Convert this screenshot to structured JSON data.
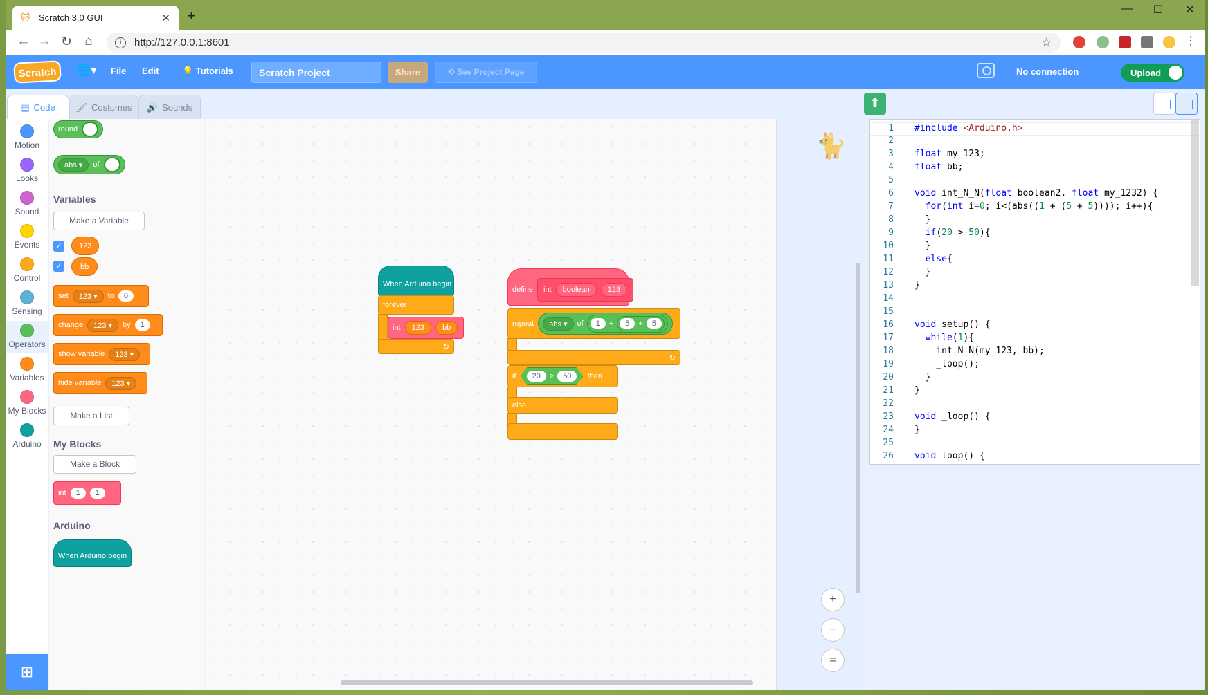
{
  "browser": {
    "tab_title": "Scratch 3.0 GUI",
    "url": "http://127.0.0.1:8601",
    "controls": {
      "minimize": "—",
      "maximize": "☐",
      "close": "✕",
      "new_tab": "+",
      "tab_close": "✕"
    }
  },
  "menubar": {
    "logo": "Scratch",
    "file": "File",
    "edit": "Edit",
    "tutorials": "Tutorials",
    "project_title": "Scratch Project",
    "share": "Share",
    "see_project_page": "See Project Page",
    "connection": "No connection",
    "upload": "Upload"
  },
  "tabs": {
    "code": "Code",
    "costumes": "Costumes",
    "sounds": "Sounds"
  },
  "categories": [
    {
      "label": "Motion",
      "color": "#4c97ff"
    },
    {
      "label": "Looks",
      "color": "#9966ff"
    },
    {
      "label": "Sound",
      "color": "#cf63cf"
    },
    {
      "label": "Events",
      "color": "#ffd500"
    },
    {
      "label": "Control",
      "color": "#ffab19"
    },
    {
      "label": "Sensing",
      "color": "#5cb1d6"
    },
    {
      "label": "Operators",
      "color": "#59c059"
    },
    {
      "label": "Variables",
      "color": "#ff8c1a"
    },
    {
      "label": "My Blocks",
      "color": "#ff6680"
    },
    {
      "label": "Arduino",
      "color": "#0fa0a0"
    }
  ],
  "palette": {
    "round_label": "round",
    "abs_label": "abs",
    "of_label": "of",
    "variables_heading": "Variables",
    "make_variable": "Make a Variable",
    "var1": "123",
    "var2": "bb",
    "set_label": "set",
    "to_label": "to",
    "set_value": "0",
    "change_label": "change",
    "by_label": "by",
    "change_value": "1",
    "show_variable": "show variable",
    "hide_variable": "hide variable",
    "make_list": "Make a List",
    "myblocks_heading": "My Blocks",
    "make_block": "Make a Block",
    "int_label": "int",
    "int_arg1": "1",
    "int_arg2": "1",
    "arduino_heading": "Arduino",
    "when_arduino_begin": "When Arduino begin"
  },
  "workspace": {
    "script1": {
      "hat": "When Arduino begin",
      "forever": "forever",
      "call": "int",
      "arg1": "123",
      "arg2": "bb"
    },
    "script2": {
      "define": "define",
      "name": "int",
      "param1": "boolean",
      "param2": "123",
      "repeat": "repeat",
      "abs": "abs",
      "of": "of",
      "v1": "1",
      "plus": "+",
      "v2": "5",
      "v3": "5",
      "if": "if",
      "cmp_a": "20",
      "gt": ">",
      "cmp_b": "50",
      "then": "then",
      "else": "else"
    }
  },
  "zoom": {
    "in": "+",
    "out": "−",
    "reset": "="
  },
  "code_lines": [
    "#include <Arduino.h>",
    "",
    "float my_123;",
    "float bb;",
    "",
    "void int_N_N(float boolean2, float my_1232) {",
    "  for(int i=0; i<(abs((1 + (5 + 5)))); i++){",
    "  }",
    "  if(20 > 50){",
    "  }",
    "  else{",
    "  }",
    "}",
    "",
    "",
    "void setup() {",
    "  while(1){",
    "    int_N_N(my_123, bb);",
    "    _loop();",
    "  }",
    "}",
    "",
    "void _loop() {",
    "}",
    "",
    "void loop() {"
  ]
}
